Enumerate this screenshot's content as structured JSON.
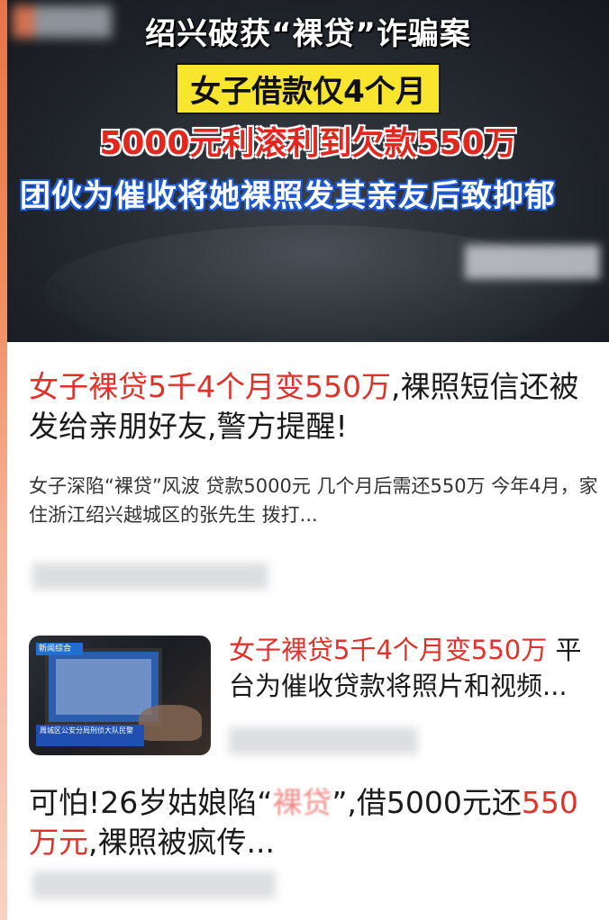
{
  "hero": {
    "caption_line1": "绍兴破获“裸贷”诈骗案",
    "caption_line2": "女子借款仅4个月",
    "caption_line3": "5000元利滚利到欠款550万",
    "caption_line4": "团伙为催收将她裸照发其亲友后致抑郁"
  },
  "feed": {
    "items": [
      {
        "title_highlight": "女子裸贷5千4个月变550万",
        "title_rest": ",裸照短信还被发给亲朋好友,警方提醒!",
        "summary": "女子深陷“裸贷”风波 贷款5000元 几个月后需还550万 今年4月，家住浙江绍兴越城区的张先生 拨打..."
      },
      {
        "title_highlight": "女子裸贷5千4个月变550万",
        "title_rest": " 平台为催收贷款将照片和视频...",
        "thumb_logo": "新闻综合",
        "thumb_caption": "周城区公安分局刑侦大队民警"
      },
      {
        "title_part1": "可怕!26岁姑娘陷“",
        "title_faded": "裸贷",
        "title_part2": "”,借5000元还",
        "title_highlight": "550万元",
        "title_part3": ",裸照被疯传..."
      }
    ]
  },
  "colors": {
    "accent_red": "#e0312a",
    "caption_yellow": "#f7e52e",
    "caption_blue_outline": "#1e5ad6"
  }
}
